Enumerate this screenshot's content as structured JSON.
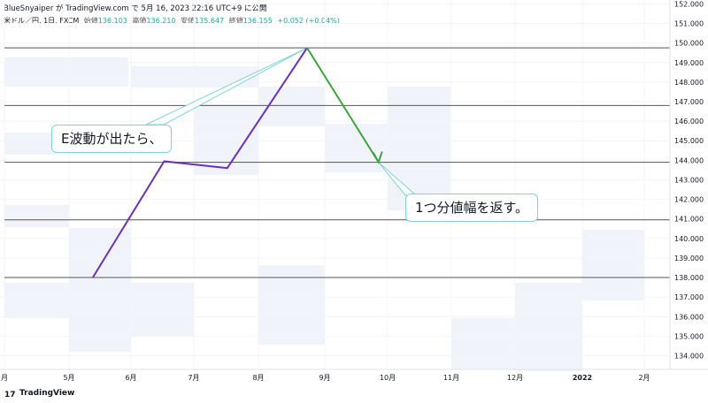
{
  "header": {
    "text": "BlueSnyaiper が TradingView.com で 5月 16, 2023 22:16 UTC+9 に公開"
  },
  "legend": {
    "symbol": "米ドル／円, 1日, FXCM",
    "open_label": "始値",
    "open": "136.103",
    "high_label": "高値",
    "high": "136.210",
    "low_label": "安値",
    "low": "135.647",
    "close_label": "終値",
    "close": "136.155",
    "change": "+0.052 (+0.04%)"
  },
  "annotations": {
    "callout1": "E波動が出たら、",
    "callout2": "1つ分値幅を返す。"
  },
  "footer": {
    "brand": "TradingView",
    "logo": "17"
  },
  "colors": {
    "up_line": "#6a2fb5",
    "down_line": "#3fa33f",
    "hline": "#555555",
    "band": "#f0f3fa",
    "callout_border": "#7fd3d6",
    "legend_value": "#26a69a"
  },
  "chart_data": {
    "type": "line",
    "x_axis": {
      "tick_labels": [
        "月",
        "5月",
        "6月",
        "7月",
        "8月",
        "9月",
        "10月",
        "11月",
        "12月",
        "2022",
        "2月"
      ]
    },
    "y_axis": {
      "ylim": [
        133.3,
        152.2
      ],
      "tick_labels": [
        "152.000",
        "151.000",
        "150.000",
        "149.000",
        "148.000",
        "147.000",
        "146.000",
        "145.000",
        "144.000",
        "143.000",
        "142.000",
        "141.000",
        "140.000",
        "139.000",
        "138.000",
        "137.000",
        "136.000",
        "135.000",
        "134.000"
      ]
    },
    "horizontal_lines": [
      149.75,
      146.8,
      143.9,
      140.95,
      138.0
    ],
    "series": [
      {
        "points": [
          {
            "x": "2021-05-13",
            "y": 138.0
          },
          {
            "x": "2021-06-16",
            "y": 143.95
          },
          {
            "x": "2021-07-16",
            "y": 143.6
          },
          {
            "x": "2021-08-23",
            "y": 149.75
          }
        ]
      },
      {
        "points": [
          {
            "x": "2021-08-23",
            "y": 149.75
          },
          {
            "x": "2021-09-26",
            "y": 143.9
          }
        ]
      }
    ],
    "grid": true,
    "legend": "none"
  }
}
